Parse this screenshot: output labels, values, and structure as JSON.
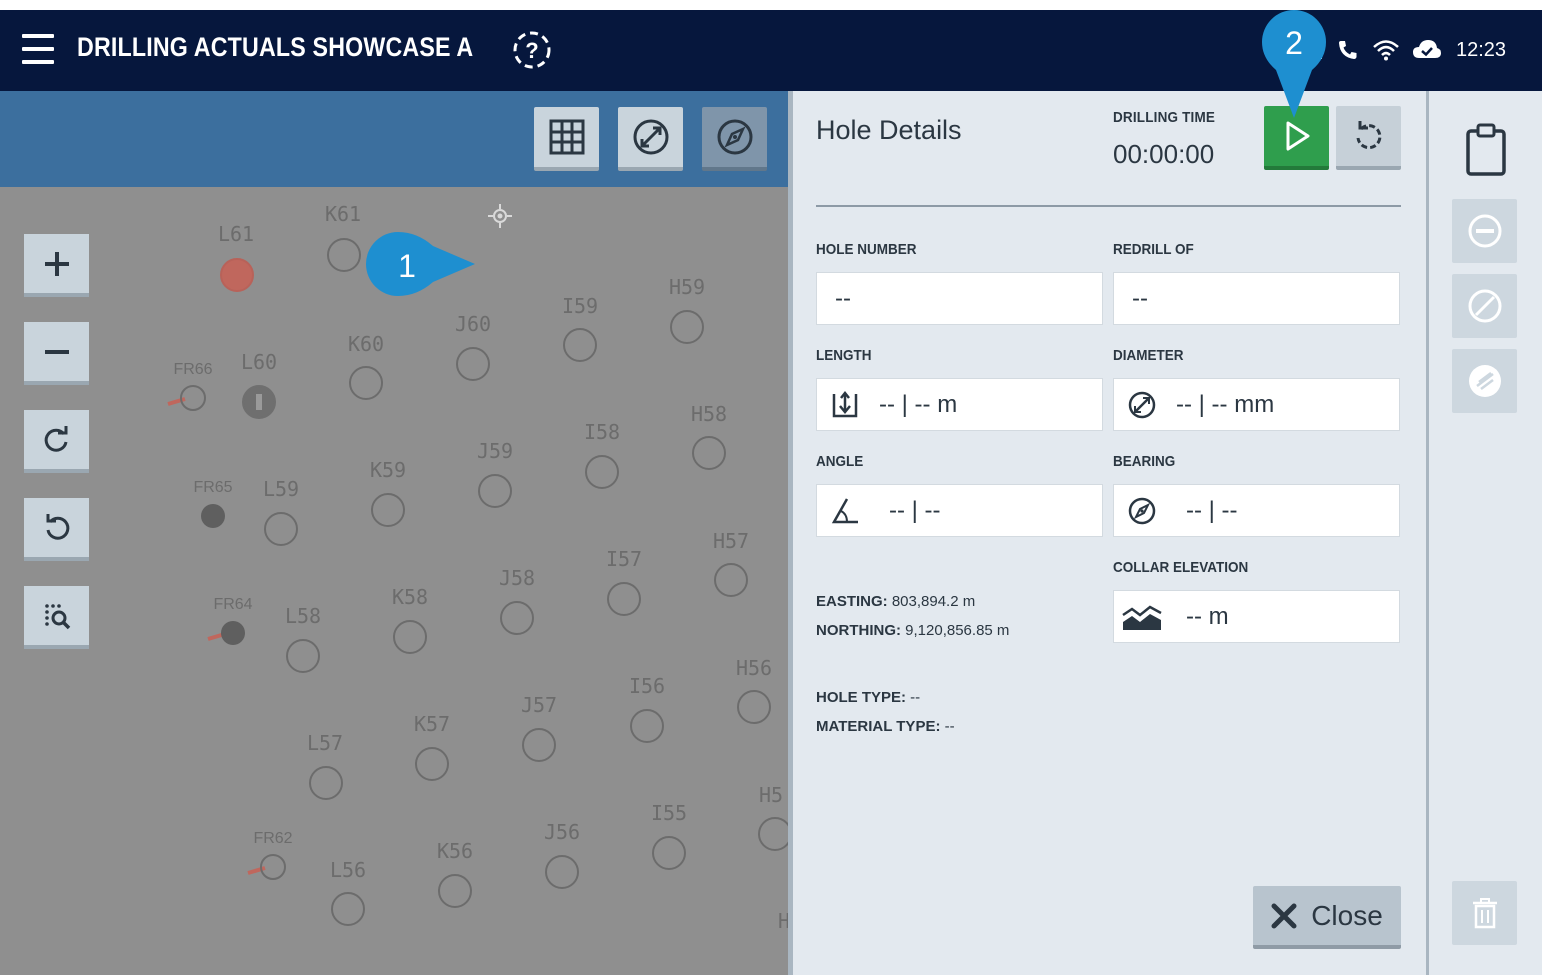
{
  "header": {
    "title": "DRILLING ACTUALS SHOWCASE A",
    "clock": "12:23"
  },
  "map": {
    "holes": [
      {
        "label": "K61",
        "state": "empty"
      },
      {
        "label": "L61",
        "state": "red"
      },
      {
        "label": "K60",
        "state": "empty"
      },
      {
        "label": "J60",
        "state": "empty"
      },
      {
        "label": "I59",
        "state": "empty"
      },
      {
        "label": "H59",
        "state": "empty"
      },
      {
        "label": "L60",
        "state": "drilled"
      },
      {
        "label": "FR66",
        "state": "empty"
      },
      {
        "label": "K59",
        "state": "empty"
      },
      {
        "label": "J59",
        "state": "empty"
      },
      {
        "label": "I58",
        "state": "empty"
      },
      {
        "label": "H58",
        "state": "empty"
      },
      {
        "label": "FR65",
        "state": "filled"
      },
      {
        "label": "L59",
        "state": "empty"
      },
      {
        "label": "K58",
        "state": "empty"
      },
      {
        "label": "J58",
        "state": "empty"
      },
      {
        "label": "I57",
        "state": "empty"
      },
      {
        "label": "H57",
        "state": "empty"
      },
      {
        "label": "FR64",
        "state": "filled"
      },
      {
        "label": "L58",
        "state": "empty"
      },
      {
        "label": "K57",
        "state": "empty"
      },
      {
        "label": "J57",
        "state": "empty"
      },
      {
        "label": "I56",
        "state": "empty"
      },
      {
        "label": "H56",
        "state": "empty"
      },
      {
        "label": "L57",
        "state": "empty"
      },
      {
        "label": "FR62",
        "state": "empty"
      },
      {
        "label": "L56",
        "state": "empty"
      },
      {
        "label": "K56",
        "state": "empty"
      },
      {
        "label": "J56",
        "state": "empty"
      },
      {
        "label": "I55",
        "state": "empty"
      },
      {
        "label": "H5",
        "state": "empty"
      },
      {
        "label": "H",
        "state": "none"
      }
    ],
    "icons": {
      "toolbar": [
        "grid-icon",
        "diameter-icon",
        "compass-icon"
      ],
      "zoom": [
        "plus-icon",
        "minus-icon",
        "rotate-cw-icon",
        "rotate-ccw-icon",
        "zoom-search-icon"
      ]
    }
  },
  "details": {
    "title": "Hole Details",
    "drilling_time_label": "DRILLING TIME",
    "drilling_time_value": "00:00:00",
    "hole_number_label": "HOLE NUMBER",
    "hole_number_value": "--",
    "redrill_label": "REDRILL OF",
    "redrill_value": "--",
    "length_label": "LENGTH",
    "length_value": "-- | -- m",
    "diameter_label": "DIAMETER",
    "diameter_value": "-- | -- mm",
    "angle_label": "ANGLE",
    "angle_value": "-- | --",
    "bearing_label": "BEARING",
    "bearing_value": "-- | --",
    "collar_label": "COLLAR ELEVATION",
    "collar_value": "-- m",
    "easting_label": "EASTING:",
    "easting_value": " 803,894.2 m",
    "northing_label": "NORTHING:",
    "northing_value": " 9,120,856.85 m",
    "hole_type_label": "HOLE TYPE:",
    "hole_type_value": " --",
    "material_type_label": "MATERIAL TYPE:",
    "material_type_value": " --",
    "close_label": "Close"
  },
  "callouts": [
    "1",
    "2"
  ],
  "colors": {
    "header_bg": "#06173d",
    "map_toolbar": "#3c6f9e",
    "map_bg": "#8f8f8f",
    "panel_bg": "#e3e9ef",
    "play_green": "#2f9e4d",
    "callout_blue": "#1e8fd0",
    "hole_red": "#c0675d"
  }
}
